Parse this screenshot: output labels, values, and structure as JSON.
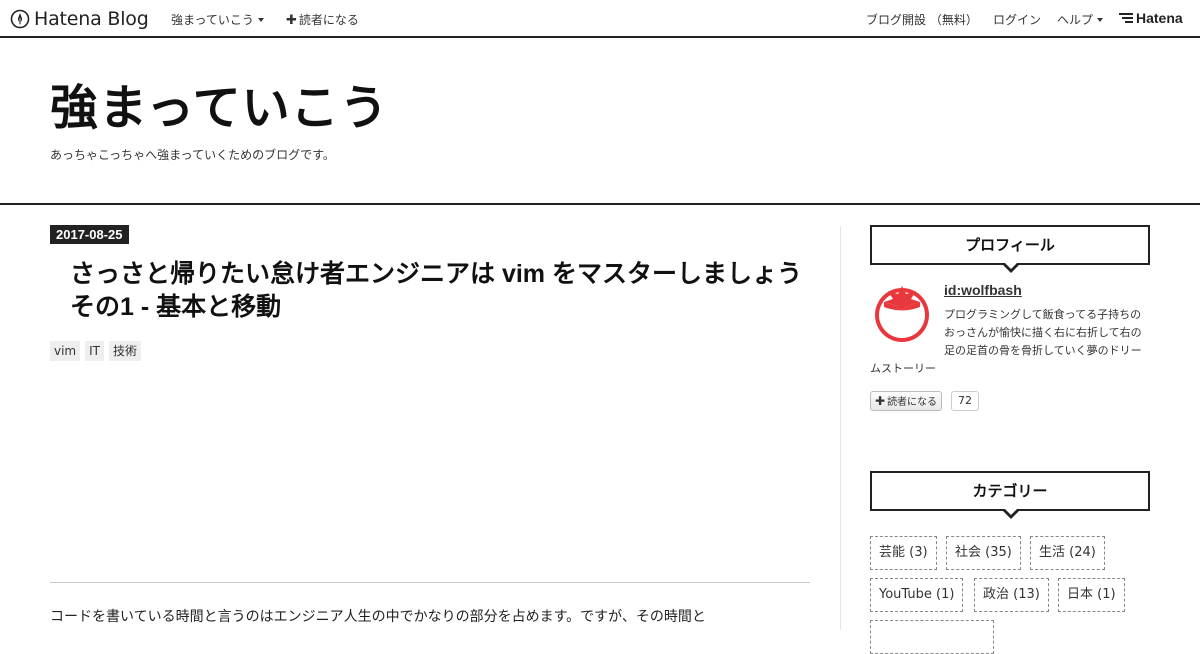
{
  "global_header": {
    "logo_text": "Hatena Blog",
    "blog_name": "強まっていこう",
    "subscribe": "読者になる",
    "links": [
      "ブログ開設 （無料）",
      "ログイン",
      "ヘルプ"
    ],
    "brand": "Hatena"
  },
  "blog": {
    "title": "強まっていこう",
    "description": "あっちゃこっちゃへ強まっていくためのブログです。"
  },
  "entry": {
    "date": "2017-08-25",
    "title": "さっさと帰りたい怠け者エンジニアは vim をマスターしましょう その1 - 基本と移動",
    "tags": [
      "vim",
      "IT",
      "技術"
    ],
    "body_start": "コードを書いている時間と言うのはエンジニア人生の中でかなりの部分を占めます。ですが、その時間と"
  },
  "sidebar": {
    "profile": {
      "heading": "プロフィール",
      "id": "id:wolfbash",
      "description": "プログラミングして飯食ってる子持ちのおっさんが愉快に描く右に右折して右の足の足首の骨を骨折していく夢のドリームストーリー",
      "subscribe": "読者になる",
      "count": "72"
    },
    "categories": {
      "heading": "カテゴリー",
      "items": [
        "芸能 (3)",
        "社会 (35)",
        "生活 (24)",
        "YouTube (1)",
        "政治 (13)",
        "日本 (1)"
      ]
    }
  },
  "colors": {
    "text": "#222222",
    "accent_red": "#e8383d",
    "badge_bg": "#222222"
  }
}
